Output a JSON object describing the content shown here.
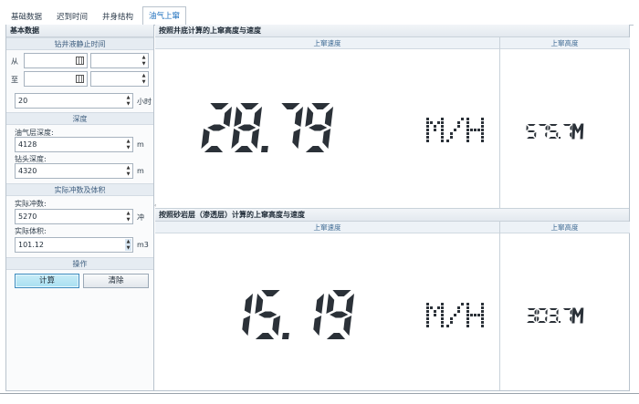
{
  "tabs": [
    "基础数据",
    "迟到时间",
    "井身结构",
    "油气上窜"
  ],
  "active_tab": 3,
  "left_panel": {
    "title": "基本数据",
    "section_stop_time": "钻井液静止时间",
    "from_label": "从",
    "to_label": "至",
    "hours_value": "20",
    "hours_unit": "小时",
    "section_depth": "深度",
    "oil_depth_label": "油气层深度:",
    "oil_depth_value": "4128",
    "depth_unit": "m",
    "bit_depth_label": "钻头深度:",
    "bit_depth_value": "4320",
    "section_cycle": "实际冲数及体积",
    "actual_strokes_label": "实际冲数:",
    "actual_strokes_value": "5270",
    "strokes_unit": "冲",
    "actual_volume_label": "实际体积:",
    "actual_volume_value": "101.12",
    "volume_unit": "m3",
    "section_ops": "操作",
    "calc_button": "计算",
    "clear_button": "清除"
  },
  "panel1": {
    "title": "按照井底计算的上窜高度与速度",
    "speed_header": "上窜速度",
    "height_header": "上窜高度",
    "speed_value": "28.79",
    "speed_unit": "M/H",
    "height_value": "575.7M"
  },
  "panel2": {
    "title": "按照砂岩层（渗透层）计算的上窜高度与速度",
    "speed_header": "上窜速度",
    "height_header": "上窜高度",
    "speed_value": "15.19",
    "speed_unit": "M/H",
    "height_value": "303.7M"
  }
}
